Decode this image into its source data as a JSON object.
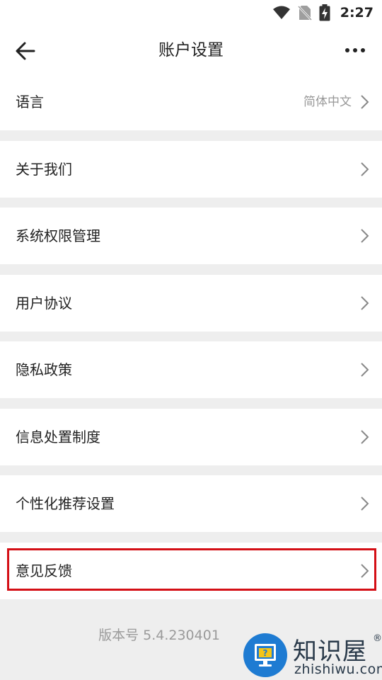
{
  "status_bar": {
    "time": "2:27",
    "icons": [
      "wifi-icon",
      "no-sim-icon",
      "battery-charging-icon"
    ]
  },
  "header": {
    "title": "账户设置",
    "back_icon": "arrow-left-icon",
    "more_icon": "more-horizontal-icon"
  },
  "settings": {
    "language": {
      "label": "语言",
      "value": "简体中文"
    },
    "about": {
      "label": "关于我们"
    },
    "permissions": {
      "label": "系统权限管理"
    },
    "user_agreement": {
      "label": "用户协议"
    },
    "privacy": {
      "label": "隐私政策"
    },
    "info_policy": {
      "label": "信息处置制度"
    },
    "personalization": {
      "label": "个性化推荐设置"
    },
    "feedback": {
      "label": "意见反馈"
    }
  },
  "footer": {
    "version": "版本号 5.4.230401"
  },
  "watermark": {
    "title": "知识屋",
    "subtitle": "zhishiwu.com",
    "registered": "®"
  },
  "colors": {
    "background": "#eeeeee",
    "highlight": "#d40f16",
    "watermark_blue": "#1e7bd2"
  }
}
